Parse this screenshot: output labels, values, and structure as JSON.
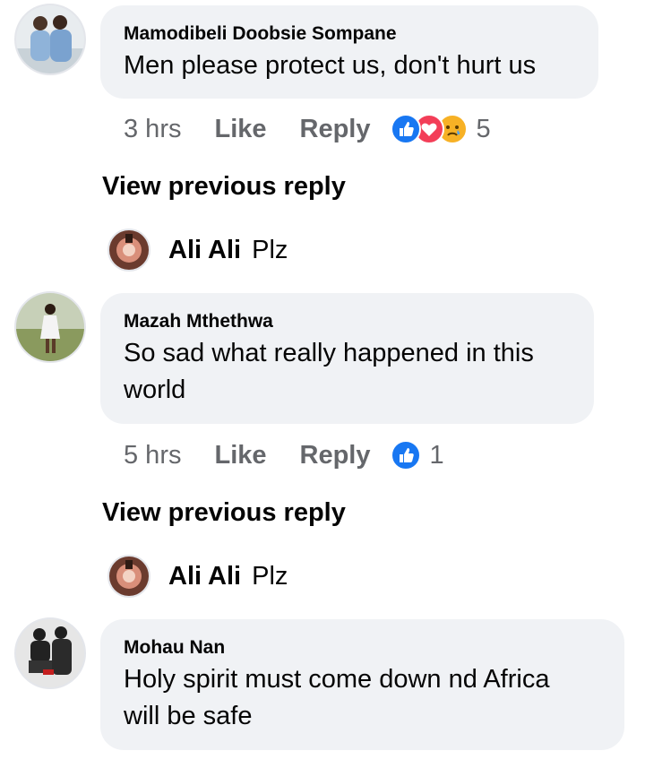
{
  "comments": [
    {
      "author": "Mamodibeli Doobsie Sompane",
      "text_lines": [
        "Men please protect us, don't hurt us"
      ],
      "time": "3 hrs",
      "like_label": "Like",
      "reply_label": "Reply",
      "reactions": [
        "like-icon",
        "love-icon",
        "sad-icon"
      ],
      "reaction_count": "5",
      "view_previous": "View previous reply",
      "reply": {
        "author": "Ali Ali",
        "text": "Plz"
      }
    },
    {
      "author": "Mazah Mthethwa",
      "text_lines": [
        "So sad what really happened in this",
        "world"
      ],
      "time": "5 hrs",
      "like_label": "Like",
      "reply_label": "Reply",
      "reactions": [
        "like-icon"
      ],
      "reaction_count": "1",
      "view_previous": "View previous reply",
      "reply": {
        "author": "Ali Ali",
        "text": "Plz"
      }
    },
    {
      "author": "Mohau Nan",
      "text_lines": [
        "Holy spirit must come down nd Africa",
        "will be safe"
      ]
    }
  ],
  "colors": {
    "bubble": "#f0f2f5",
    "meta_text": "#65676b",
    "like_blue": "#1877f2",
    "love_red": "#f33e58",
    "sad_yellow": "#f7b125"
  }
}
